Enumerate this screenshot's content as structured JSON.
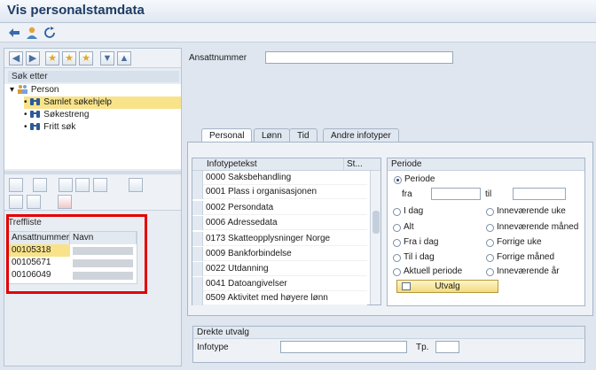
{
  "window": {
    "title": "Vis personalstamdata"
  },
  "left": {
    "search_label": "Søk etter",
    "tree": {
      "root": "Person",
      "items": [
        "Samlet søkehjelp",
        "Søkestreng",
        "Fritt søk"
      ]
    },
    "hitlist": {
      "label": "Treffliste",
      "columns": [
        "Ansattnummer",
        "Navn"
      ],
      "rows": [
        "00105318",
        "00105671",
        "00106049"
      ]
    }
  },
  "header": {
    "employee_label": "Ansattnummer",
    "employee_value": ""
  },
  "tabs": [
    "Personal",
    "Lønn",
    "Tid",
    "Andre infotyper"
  ],
  "infotype_list": {
    "columns": [
      "Infotypetekst",
      "St..."
    ],
    "rows": [
      "0000 Saksbehandling",
      "0001 Plass i organisasjonen",
      "0002 Persondata",
      "0006 Adressedata",
      "0173 Skatteopplysninger Norge",
      "0009 Bankforbindelse",
      "0022 Utdanning",
      "0041 Datoangivelser",
      "0509 Aktivitet med høyere lønn"
    ]
  },
  "period": {
    "header": "Periode",
    "periode_option": "Periode",
    "from_label": "fra",
    "to_label": "til",
    "left_options": [
      "I dag",
      "Alt",
      "Fra i dag",
      "Til i dag",
      "Aktuell periode"
    ],
    "right_options": [
      "Inneværende uke",
      "Inneværende måned",
      "Forrige uke",
      "Forrige måned",
      "Inneværende år"
    ],
    "button": "Utvalg"
  },
  "direct": {
    "header": "Drekte utvalg",
    "infotype_label": "Infotype",
    "tp_label": "Tp."
  }
}
